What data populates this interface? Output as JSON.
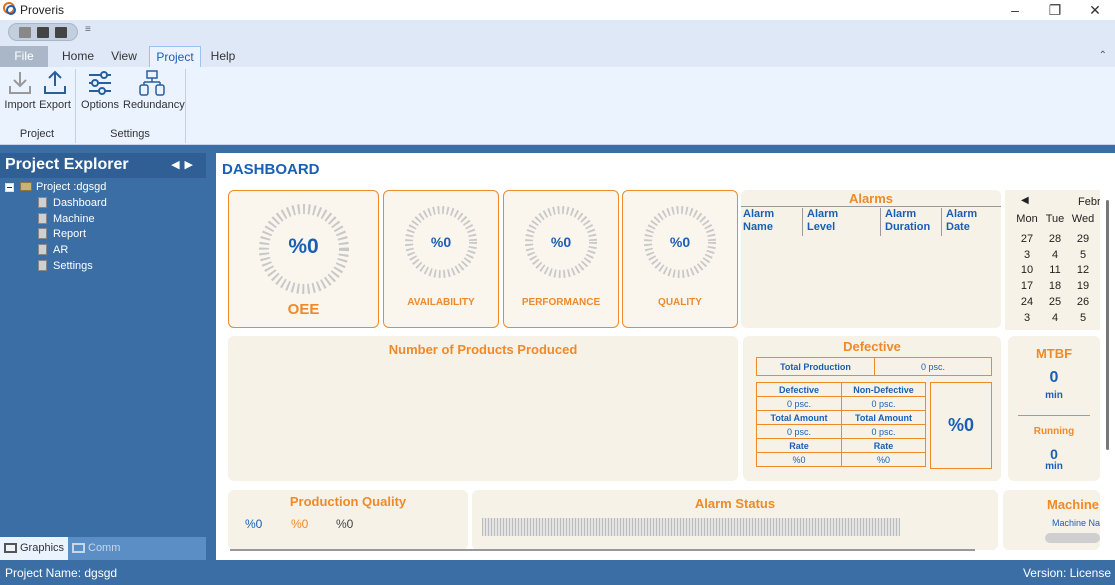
{
  "window": {
    "title": "Proveris"
  },
  "ribbon": {
    "tabs": [
      {
        "label": "File"
      },
      {
        "label": "Home"
      },
      {
        "label": "View"
      },
      {
        "label": "Project",
        "active": true
      },
      {
        "label": "Help"
      }
    ],
    "project_group": {
      "label": "Project",
      "buttons": [
        {
          "label": "Import"
        },
        {
          "label": "Export"
        }
      ]
    },
    "settings_group": {
      "label": "Settings",
      "buttons": [
        {
          "label": "Options"
        },
        {
          "label": "Redundancy"
        }
      ]
    }
  },
  "explorer": {
    "title": "Project Explorer",
    "project": "Project :dgsgd",
    "items": [
      {
        "label": "Dashboard"
      },
      {
        "label": "Machine"
      },
      {
        "label": "Report"
      },
      {
        "label": "AR"
      },
      {
        "label": "Settings"
      }
    ],
    "tabs": [
      {
        "label": "Graphics"
      },
      {
        "label": "Comm"
      }
    ]
  },
  "dashboard": {
    "title": "DASHBOARD",
    "kpis": [
      {
        "value": "%0",
        "label": "OEE"
      },
      {
        "value": "%0",
        "label": "AVAILABILITY"
      },
      {
        "value": "%0",
        "label": "PERFORMANCE"
      },
      {
        "value": "%0",
        "label": "QUALITY"
      }
    ],
    "alarms": {
      "title": "Alarms",
      "columns": [
        {
          "l1": "Alarm",
          "l2": "Name"
        },
        {
          "l1": "Alarm",
          "l2": "Level"
        },
        {
          "l1": "Alarm",
          "l2": "Duration"
        },
        {
          "l1": "Alarm",
          "l2": "Date"
        }
      ]
    },
    "calendar": {
      "month": "Febr",
      "days": [
        "Mon",
        "Tue",
        "Wed"
      ],
      "weeks": [
        [
          "27",
          "28",
          "29"
        ],
        [
          "3",
          "4",
          "5"
        ],
        [
          "10",
          "11",
          "12"
        ],
        [
          "17",
          "18",
          "19"
        ],
        [
          "24",
          "25",
          "26"
        ],
        [
          "3",
          "4",
          "5"
        ]
      ]
    },
    "products": {
      "title": "Number of Products Produced"
    },
    "defective": {
      "title": "Defective",
      "total_production_label": "Total Production",
      "total_production_value": "0 psc.",
      "defective_label": "Defective",
      "non_defective_label": "Non-Defective",
      "defective_value": "0 psc.",
      "non_defective_value": "0 psc.",
      "total_amount_label": "Total Amount",
      "total_amount_left": "0 psc.",
      "total_amount_right": "0 psc.",
      "rate_label": "Rate",
      "rate_left": "%0",
      "rate_right": "%0",
      "percent": "%0"
    },
    "mtbf": {
      "title": "MTBF",
      "value": "0",
      "unit": "min",
      "running_label": "Running",
      "running_value": "0",
      "running_unit": "min"
    },
    "production_quality": {
      "title": "Production Quality",
      "values": [
        "%0",
        "%0",
        "%0"
      ]
    },
    "alarm_status": {
      "title": "Alarm Status"
    },
    "machine": {
      "title": "Machine",
      "subtitle": "Machine Na"
    }
  },
  "status": {
    "project_name": "Project Name: dgsgd",
    "version": "Version: License"
  },
  "colors": {
    "accent_blue": "#1a5fb4",
    "accent_orange": "#ee8a2a",
    "chrome_blue": "#3a6ea5"
  }
}
